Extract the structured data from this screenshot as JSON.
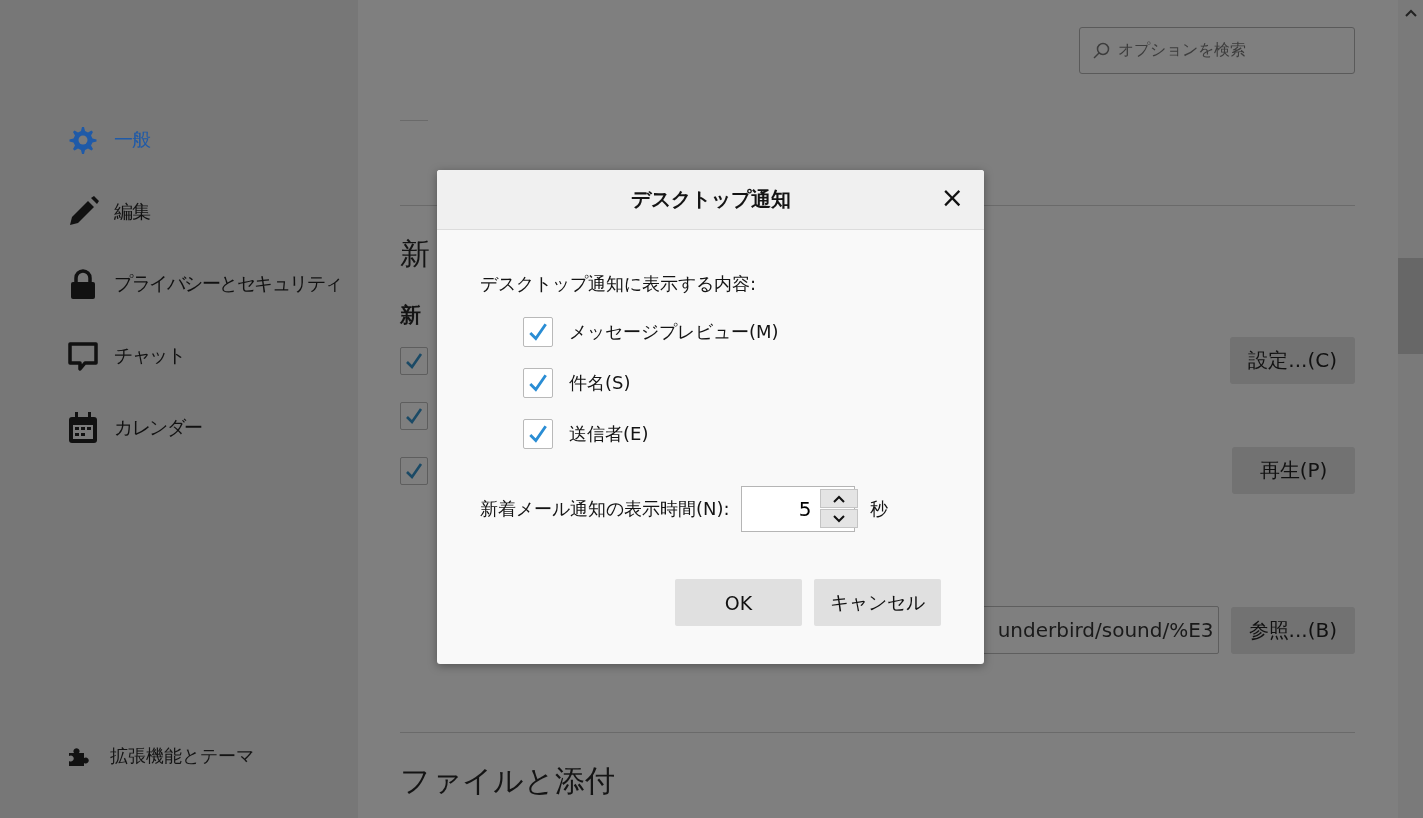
{
  "sidebar": {
    "items": [
      {
        "label": "一般",
        "selected": true
      },
      {
        "label": "編集",
        "selected": false
      },
      {
        "label": "プライバシーとセキュリティ",
        "selected": false
      },
      {
        "label": "チャット",
        "selected": false
      },
      {
        "label": "カレンダー",
        "selected": false
      }
    ],
    "footer": {
      "label": "拡張機能とテーマ"
    }
  },
  "search": {
    "placeholder": "オプションを検索"
  },
  "content": {
    "section_heading": "新",
    "subheading": "新",
    "checkboxes": [
      {
        "checked": true,
        "button": "設定...(C)"
      },
      {
        "checked": true
      },
      {
        "checked": true,
        "button": "再生(P)"
      }
    ],
    "sound_file": {
      "value": "underbird/sound/%E3",
      "button": "参照...(B)"
    },
    "next_heading": "ファイルと添付"
  },
  "dialog": {
    "title": "デスクトップ通知",
    "close": "×",
    "intro": "デスクトップ通知に表示する内容:",
    "options": [
      {
        "label": "メッセージプレビュー(M)",
        "checked": true
      },
      {
        "label": "件名(S)",
        "checked": true
      },
      {
        "label": "送信者(E)",
        "checked": true
      }
    ],
    "duration": {
      "label": "新着メール通知の表示時間(N):",
      "value": "5",
      "unit": "秒"
    },
    "buttons": [
      "OK",
      "キャンセル"
    ]
  }
}
